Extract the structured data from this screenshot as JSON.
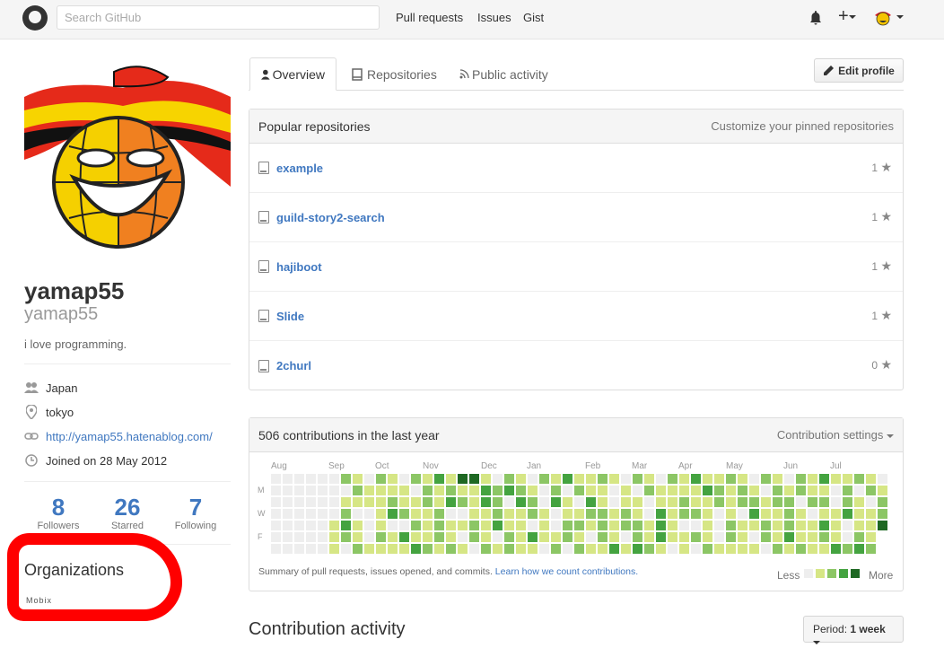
{
  "header": {
    "search_placeholder": "Search GitHub",
    "nav": [
      "Pull requests",
      "Issues",
      "Gist"
    ],
    "plus": "+"
  },
  "profile": {
    "fullname": "yamap55",
    "username": "yamap55",
    "bio": "i love programming.",
    "company": "Japan",
    "location": "tokyo",
    "url": "http://yamap55.hatenablog.com/",
    "joined": "Joined on 28 May 2012",
    "stats": [
      {
        "num": "8",
        "label": "Followers"
      },
      {
        "num": "26",
        "label": "Starred"
      },
      {
        "num": "7",
        "label": "Following"
      }
    ],
    "orgs_title": "Organizations",
    "org_logo": "Mobix"
  },
  "tabs": [
    "Overview",
    "Repositories",
    "Public activity"
  ],
  "edit_profile": "Edit profile",
  "popular": {
    "title": "Popular repositories",
    "customize": "Customize your pinned repositories",
    "repos": [
      {
        "name": "example",
        "stars": "1"
      },
      {
        "name": "guild-story2-search",
        "stars": "1"
      },
      {
        "name": "hajiboot",
        "stars": "1"
      },
      {
        "name": "Slide",
        "stars": "1"
      },
      {
        "name": "2churl",
        "stars": "0"
      }
    ]
  },
  "contrib": {
    "title": "506 contributions in the last year",
    "settings": "Contribution settings",
    "months": [
      "Aug",
      "Sep",
      "Oct",
      "Nov",
      "Dec",
      "Jan",
      "Feb",
      "Mar",
      "Apr",
      "May",
      "Jun",
      "Jul"
    ],
    "days": [
      "M",
      "W",
      "F"
    ],
    "summary": "Summary of pull requests, issues opened, and commits.",
    "learn": "Learn how we count contributions.",
    "less": "Less",
    "more": "More",
    "colors": [
      "#eeeeee",
      "#d6e685",
      "#8cc665",
      "#44a340",
      "#1e6823"
    ]
  },
  "activity": {
    "title": "Contribution activity",
    "period_label": "Period:",
    "period_value": "1 week"
  }
}
